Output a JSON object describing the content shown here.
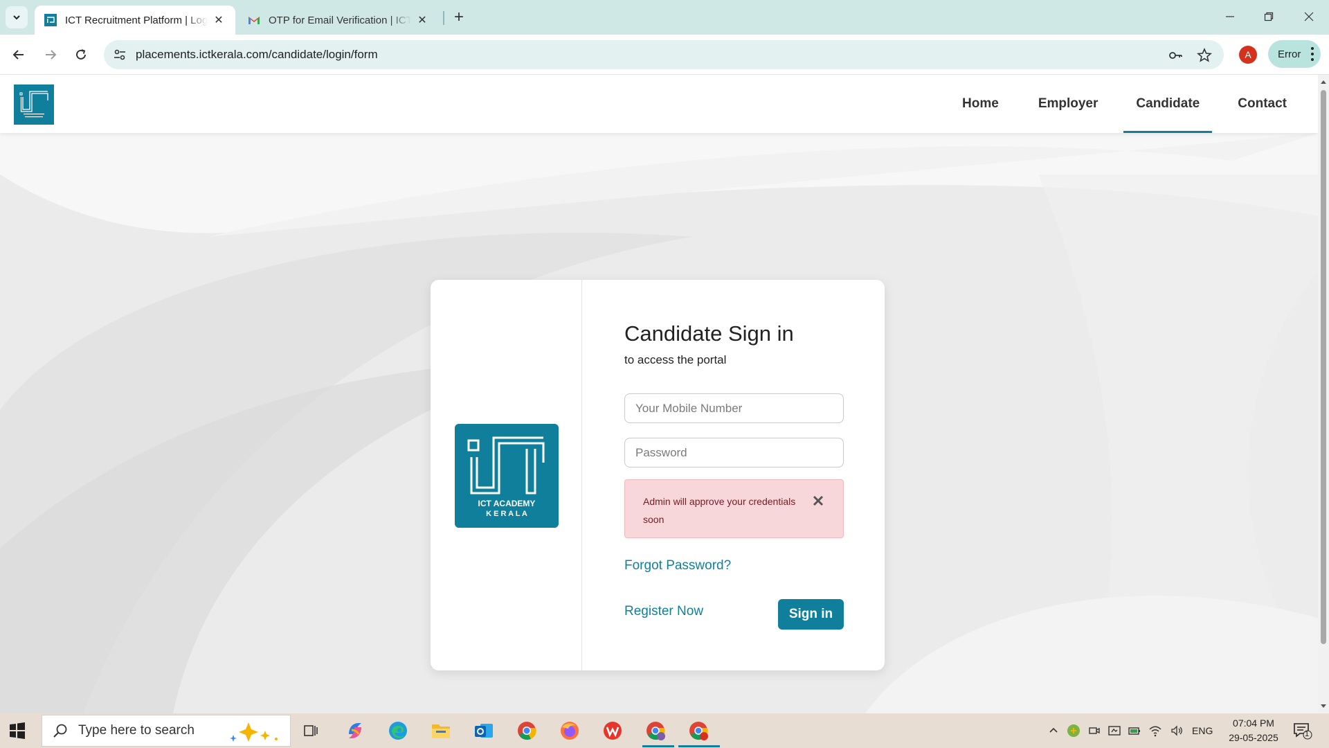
{
  "browser": {
    "tabs": [
      {
        "title": "ICT Recruitment Platform | Login",
        "active": true
      },
      {
        "title": "OTP for Email Verification | ICT Academy",
        "active": false
      }
    ],
    "url": "placements.ictkerala.com/candidate/login/form",
    "profile_initial": "A",
    "profile_status": "Error"
  },
  "site": {
    "nav": [
      {
        "label": "Home",
        "active": false
      },
      {
        "label": "Employer",
        "active": false
      },
      {
        "label": "Candidate",
        "active": true
      },
      {
        "label": "Contact",
        "active": false
      }
    ]
  },
  "login": {
    "heading": "Candidate Sign in",
    "subheading": "to access the portal",
    "mobile_placeholder": "Your Mobile Number",
    "password_placeholder": "Password",
    "alert": "Admin will approve your credentials soon",
    "forgot": "Forgot Password?",
    "register": "Register Now",
    "submit": "Sign in",
    "logo_line1": "ICT ACADEMY",
    "logo_line2": "K E R A L A"
  },
  "taskbar": {
    "search_placeholder": "Type here to search",
    "lang": "ENG",
    "time": "07:04 PM",
    "date": "29-05-2025",
    "notifications": "1"
  },
  "colors": {
    "brand": "#0f7f9c",
    "alert_bg": "#f8d7da",
    "alert_text": "#721c24"
  }
}
